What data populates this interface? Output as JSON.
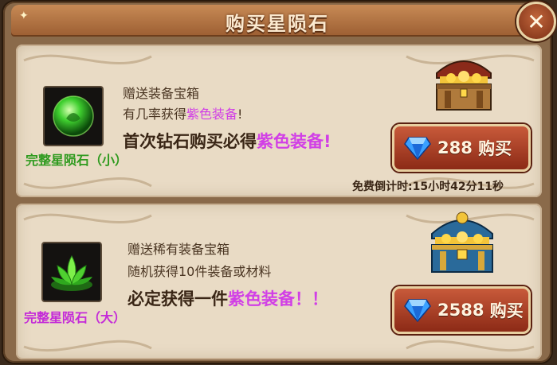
{
  "dialog": {
    "title": "购买星陨石"
  },
  "items": [
    {
      "name": "完整星陨石（小）",
      "name_color": "#2e9a1e",
      "desc1": "赠送装备宝箱",
      "desc2_prefix": "有几率获得",
      "desc2_highlight": "紫色装备",
      "desc2_suffix": "!",
      "promo_prefix": "首次钻石购买必得",
      "promo_highlight": "紫色装备",
      "promo_suffix": "!",
      "price": "288",
      "buy_label": "购买",
      "timer": "免费倒计时:15小时42分11秒",
      "icon": "green-orb-icon",
      "chest_icon": "treasure-chest-icon"
    },
    {
      "name": "完整星陨石（大）",
      "name_color": "#c42ad8",
      "desc1": "赠送稀有装备宝箱",
      "desc2_prefix": "随机获得10件装备或材料",
      "desc2_highlight": "",
      "desc2_suffix": "",
      "promo_prefix": "必定获得一件",
      "promo_highlight": "紫色装备",
      "promo_suffix": "！！",
      "price": "2588",
      "buy_label": "购买",
      "icon": "green-lotus-icon",
      "chest_icon": "rare-treasure-chest-icon"
    }
  ],
  "colors": {
    "highlight": "#d13fe6",
    "panel": "#e9dbc5",
    "button": "#a23a22"
  }
}
